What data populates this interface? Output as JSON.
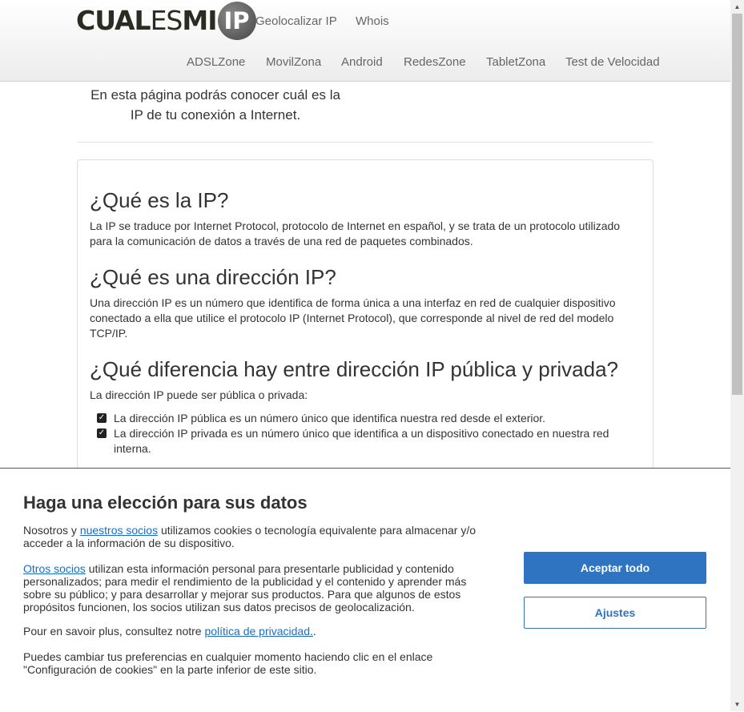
{
  "header": {
    "logo": {
      "part1": "CUAL",
      "part2": "ES",
      "part3": "MI",
      "circle": "IP"
    },
    "nav_top": [
      "Geolocalizar IP",
      "Whois"
    ],
    "nav_bottom": [
      "ADSLZone",
      "MovilZona",
      "Android",
      "RedesZone",
      "TabletZona",
      "Test de Velocidad"
    ]
  },
  "intro": {
    "line1": "En esta página podrás conocer cuál es la",
    "line2": "IP de tu conexión a Internet."
  },
  "sections": [
    {
      "title": "¿Qué es la IP?",
      "body": "La IP se traduce por Internet Protocol, protocolo de Internet en español, y se trata de un protocolo utilizado para la comunicación de datos a través de una red de paquetes combinados."
    },
    {
      "title": "¿Qué es una dirección IP?",
      "body": "Una dirección IP es un número que identifica de forma única a una interfaz en red de cualquier dispositivo conectado a ella que utilice el protocolo IP (Internet Protocol), que corresponde al nivel de red del modelo TCP/IP."
    },
    {
      "title": "¿Qué diferencia hay entre dirección IP pública y privada?",
      "body": "La dirección IP puede ser pública o privada:",
      "items": [
        "La dirección IP pública es un número único que identifica nuestra red desde el exterior.",
        "La dirección IP privada es un número único que identifica a un dispositivo conectado en nuestra red interna."
      ]
    }
  ],
  "cookie": {
    "title": "Haga una elección para sus datos",
    "p1_pre": "Nosotros y ",
    "p1_link": "nuestros socios",
    "p1_post": " utilizamos cookies o tecnología equivalente para almacenar y/o acceder a la información de su dispositivo.",
    "p2_link": "Otros socios",
    "p2_post": " utilizan esta información personal para presentarle publicidad y contenido personalizados; para medir el rendimiento de la publicidad y el contenido y aprender más sobre su público; y para desarrollar y mejorar sus productos. Para que algunos de estos propósitos funcionen, los socios utilizan sus datos precisos de geolocalización.",
    "p3_pre": "Pour en savoir plus, consultez notre ",
    "p3_link": "política de privacidad.",
    "p3_post": ".",
    "p4": "Puedes cambiar tus preferencias en cualquier momento haciendo clic en el enlace \"Configuración de cookies\" en la parte inferior de este sitio.",
    "accept_label": "Aceptar todo",
    "settings_label": "Ajustes"
  },
  "colors": {
    "accent": "#2f74c0",
    "link": "#1a6ec2"
  }
}
